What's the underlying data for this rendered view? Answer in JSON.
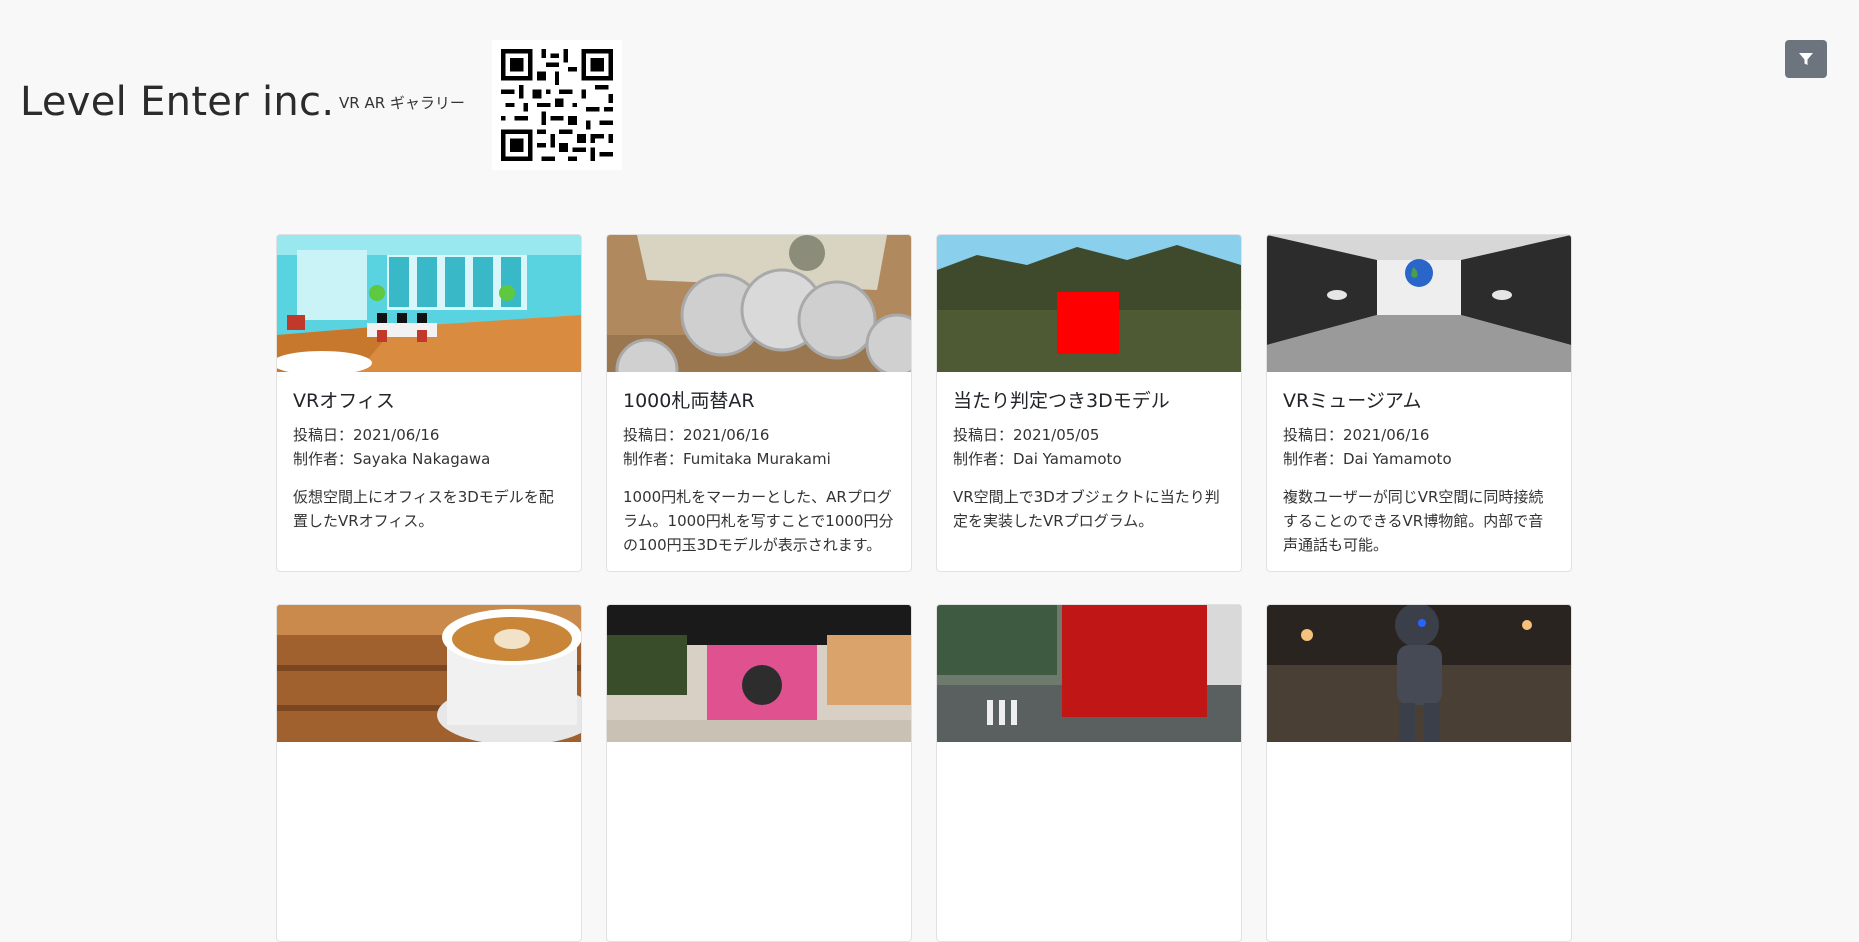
{
  "header": {
    "brand": "Level Enter inc.",
    "tagline": "VR AR ギャラリー",
    "filter_icon": "filter-icon"
  },
  "cards": [
    {
      "title": "VRオフィス",
      "date": "投稿日：2021/06/16",
      "author": "制作者：Sayaka Nakagawa",
      "description": "仮想空間上にオフィスを3Dモデルを配置したVRオフィス。"
    },
    {
      "title": "1000札両替AR",
      "date": "投稿日：2021/06/16",
      "author": "制作者：Fumitaka Murakami",
      "description": "1000円札をマーカーとした、ARプログラム。1000円札を写すことで1000円分の100円玉3Dモデルが表示されます。"
    },
    {
      "title": "当たり判定つき3Dモデル",
      "date": "投稿日：2021/05/05",
      "author": "制作者：Dai Yamamoto",
      "description": "VR空間上で3Dオブジェクトに当たり判定を実装したVRプログラム。"
    },
    {
      "title": "VRミュージアム",
      "date": "投稿日：2021/06/16",
      "author": "制作者：Dai Yamamoto",
      "description": "複数ユーザーが同じVR空間に同時接続することのできるVR博物館。内部で音声通話も可能。"
    },
    {
      "title": "",
      "date": "",
      "author": "",
      "description": ""
    },
    {
      "title": "",
      "date": "",
      "author": "",
      "description": ""
    },
    {
      "title": "",
      "date": "",
      "author": "",
      "description": ""
    },
    {
      "title": "",
      "date": "",
      "author": "",
      "description": ""
    }
  ],
  "colors": {
    "button_bg": "#6c757d",
    "page_bg": "#f8f8f8"
  }
}
